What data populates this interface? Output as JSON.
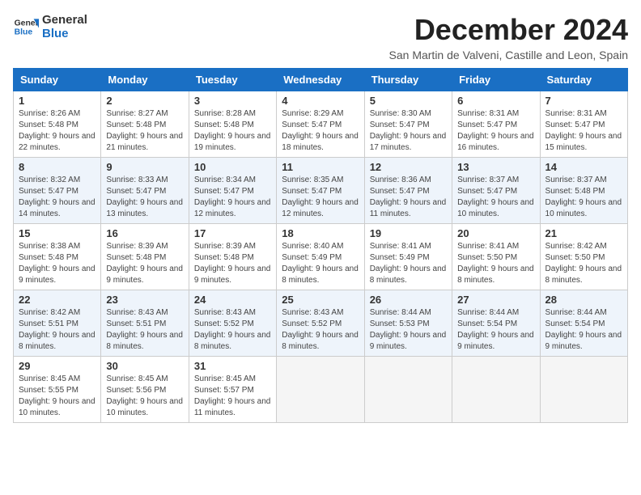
{
  "logo": {
    "line1": "General",
    "line2": "Blue"
  },
  "title": "December 2024",
  "subtitle": "San Martin de Valveni, Castille and Leon, Spain",
  "days_of_week": [
    "Sunday",
    "Monday",
    "Tuesday",
    "Wednesday",
    "Thursday",
    "Friday",
    "Saturday"
  ],
  "weeks": [
    [
      {
        "day": "1",
        "sunrise": "8:26 AM",
        "sunset": "5:48 PM",
        "daylight": "9 hours and 22 minutes."
      },
      {
        "day": "2",
        "sunrise": "8:27 AM",
        "sunset": "5:48 PM",
        "daylight": "9 hours and 21 minutes."
      },
      {
        "day": "3",
        "sunrise": "8:28 AM",
        "sunset": "5:48 PM",
        "daylight": "9 hours and 19 minutes."
      },
      {
        "day": "4",
        "sunrise": "8:29 AM",
        "sunset": "5:47 PM",
        "daylight": "9 hours and 18 minutes."
      },
      {
        "day": "5",
        "sunrise": "8:30 AM",
        "sunset": "5:47 PM",
        "daylight": "9 hours and 17 minutes."
      },
      {
        "day": "6",
        "sunrise": "8:31 AM",
        "sunset": "5:47 PM",
        "daylight": "9 hours and 16 minutes."
      },
      {
        "day": "7",
        "sunrise": "8:31 AM",
        "sunset": "5:47 PM",
        "daylight": "9 hours and 15 minutes."
      }
    ],
    [
      {
        "day": "8",
        "sunrise": "8:32 AM",
        "sunset": "5:47 PM",
        "daylight": "9 hours and 14 minutes."
      },
      {
        "day": "9",
        "sunrise": "8:33 AM",
        "sunset": "5:47 PM",
        "daylight": "9 hours and 13 minutes."
      },
      {
        "day": "10",
        "sunrise": "8:34 AM",
        "sunset": "5:47 PM",
        "daylight": "9 hours and 12 minutes."
      },
      {
        "day": "11",
        "sunrise": "8:35 AM",
        "sunset": "5:47 PM",
        "daylight": "9 hours and 12 minutes."
      },
      {
        "day": "12",
        "sunrise": "8:36 AM",
        "sunset": "5:47 PM",
        "daylight": "9 hours and 11 minutes."
      },
      {
        "day": "13",
        "sunrise": "8:37 AM",
        "sunset": "5:47 PM",
        "daylight": "9 hours and 10 minutes."
      },
      {
        "day": "14",
        "sunrise": "8:37 AM",
        "sunset": "5:48 PM",
        "daylight": "9 hours and 10 minutes."
      }
    ],
    [
      {
        "day": "15",
        "sunrise": "8:38 AM",
        "sunset": "5:48 PM",
        "daylight": "9 hours and 9 minutes."
      },
      {
        "day": "16",
        "sunrise": "8:39 AM",
        "sunset": "5:48 PM",
        "daylight": "9 hours and 9 minutes."
      },
      {
        "day": "17",
        "sunrise": "8:39 AM",
        "sunset": "5:48 PM",
        "daylight": "9 hours and 9 minutes."
      },
      {
        "day": "18",
        "sunrise": "8:40 AM",
        "sunset": "5:49 PM",
        "daylight": "9 hours and 8 minutes."
      },
      {
        "day": "19",
        "sunrise": "8:41 AM",
        "sunset": "5:49 PM",
        "daylight": "9 hours and 8 minutes."
      },
      {
        "day": "20",
        "sunrise": "8:41 AM",
        "sunset": "5:50 PM",
        "daylight": "9 hours and 8 minutes."
      },
      {
        "day": "21",
        "sunrise": "8:42 AM",
        "sunset": "5:50 PM",
        "daylight": "9 hours and 8 minutes."
      }
    ],
    [
      {
        "day": "22",
        "sunrise": "8:42 AM",
        "sunset": "5:51 PM",
        "daylight": "9 hours and 8 minutes."
      },
      {
        "day": "23",
        "sunrise": "8:43 AM",
        "sunset": "5:51 PM",
        "daylight": "9 hours and 8 minutes."
      },
      {
        "day": "24",
        "sunrise": "8:43 AM",
        "sunset": "5:52 PM",
        "daylight": "9 hours and 8 minutes."
      },
      {
        "day": "25",
        "sunrise": "8:43 AM",
        "sunset": "5:52 PM",
        "daylight": "9 hours and 8 minutes."
      },
      {
        "day": "26",
        "sunrise": "8:44 AM",
        "sunset": "5:53 PM",
        "daylight": "9 hours and 9 minutes."
      },
      {
        "day": "27",
        "sunrise": "8:44 AM",
        "sunset": "5:54 PM",
        "daylight": "9 hours and 9 minutes."
      },
      {
        "day": "28",
        "sunrise": "8:44 AM",
        "sunset": "5:54 PM",
        "daylight": "9 hours and 9 minutes."
      }
    ],
    [
      {
        "day": "29",
        "sunrise": "8:45 AM",
        "sunset": "5:55 PM",
        "daylight": "9 hours and 10 minutes."
      },
      {
        "day": "30",
        "sunrise": "8:45 AM",
        "sunset": "5:56 PM",
        "daylight": "9 hours and 10 minutes."
      },
      {
        "day": "31",
        "sunrise": "8:45 AM",
        "sunset": "5:57 PM",
        "daylight": "9 hours and 11 minutes."
      },
      null,
      null,
      null,
      null
    ]
  ],
  "labels": {
    "sunrise": "Sunrise:",
    "sunset": "Sunset:",
    "daylight": "Daylight:"
  }
}
